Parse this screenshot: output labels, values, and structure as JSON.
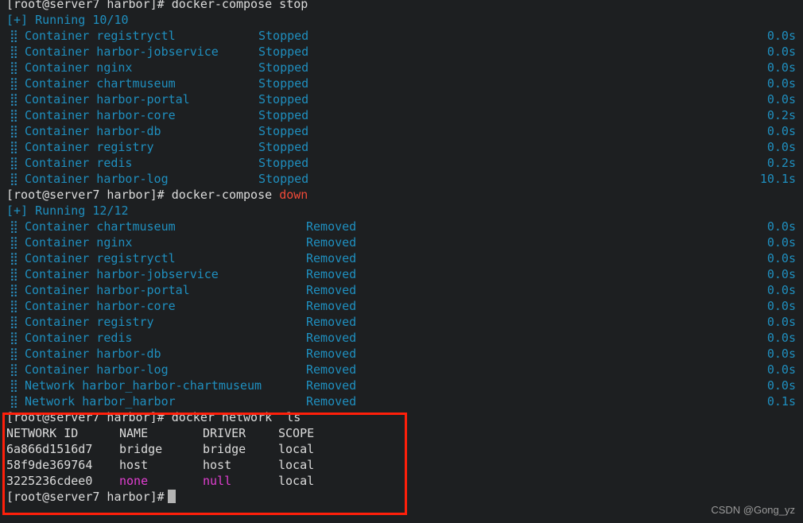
{
  "terminal": {
    "background": "#1d1f21",
    "foreground": "#dcdcdc",
    "accent_cyan": "#1f8fbf",
    "accent_red": "#f04a38",
    "accent_magenta": "#e23fd2",
    "annotation_box_color": "#ff1f0a",
    "bullet_glyph": "⣿"
  },
  "prompt": {
    "text": "[root@server7 harbor]# ",
    "cmd_stop": "docker-compose stop",
    "cmd_down_prefix": "docker-compose ",
    "cmd_down_arg": "down",
    "cmd_network_ls": "docker network  ls"
  },
  "stop_block": {
    "header": "[+] Running 10/10",
    "status_label": "Stopped",
    "rows": [
      {
        "kind": "Container",
        "name": "registryctl",
        "status": "Stopped",
        "time": "0.0s"
      },
      {
        "kind": "Container",
        "name": "harbor-jobservice",
        "status": "Stopped",
        "time": "0.0s"
      },
      {
        "kind": "Container",
        "name": "nginx",
        "status": "Stopped",
        "time": "0.0s"
      },
      {
        "kind": "Container",
        "name": "chartmuseum",
        "status": "Stopped",
        "time": "0.0s"
      },
      {
        "kind": "Container",
        "name": "harbor-portal",
        "status": "Stopped",
        "time": "0.0s"
      },
      {
        "kind": "Container",
        "name": "harbor-core",
        "status": "Stopped",
        "time": "0.2s"
      },
      {
        "kind": "Container",
        "name": "harbor-db",
        "status": "Stopped",
        "time": "0.0s"
      },
      {
        "kind": "Container",
        "name": "registry",
        "status": "Stopped",
        "time": "0.0s"
      },
      {
        "kind": "Container",
        "name": "redis",
        "status": "Stopped",
        "time": "0.2s"
      },
      {
        "kind": "Container",
        "name": "harbor-log",
        "status": "Stopped",
        "time": "10.1s"
      }
    ]
  },
  "down_block": {
    "header": "[+] Running 12/12",
    "status_label": "Removed",
    "rows": [
      {
        "kind": "Container",
        "name": "chartmuseum",
        "status": "Removed",
        "time": "0.0s"
      },
      {
        "kind": "Container",
        "name": "nginx",
        "status": "Removed",
        "time": "0.0s"
      },
      {
        "kind": "Container",
        "name": "registryctl",
        "status": "Removed",
        "time": "0.0s"
      },
      {
        "kind": "Container",
        "name": "harbor-jobservice",
        "status": "Removed",
        "time": "0.0s"
      },
      {
        "kind": "Container",
        "name": "harbor-portal",
        "status": "Removed",
        "time": "0.0s"
      },
      {
        "kind": "Container",
        "name": "harbor-core",
        "status": "Removed",
        "time": "0.0s"
      },
      {
        "kind": "Container",
        "name": "registry",
        "status": "Removed",
        "time": "0.0s"
      },
      {
        "kind": "Container",
        "name": "redis",
        "status": "Removed",
        "time": "0.0s"
      },
      {
        "kind": "Container",
        "name": "harbor-db",
        "status": "Removed",
        "time": "0.0s"
      },
      {
        "kind": "Container",
        "name": "harbor-log",
        "status": "Removed",
        "time": "0.0s"
      },
      {
        "kind": "Network",
        "name": "harbor_harbor-chartmuseum",
        "status": "Removed",
        "time": "0.0s"
      },
      {
        "kind": "Network",
        "name": "harbor_harbor",
        "status": "Removed",
        "time": "0.1s"
      }
    ]
  },
  "network_table": {
    "headers": [
      "NETWORK ID",
      "NAME",
      "DRIVER",
      "SCOPE"
    ],
    "rows": [
      {
        "id": "6a866d1516d7",
        "name": "bridge",
        "driver": "bridge",
        "scope": "local",
        "highlight": false
      },
      {
        "id": "58f9de369764",
        "name": "host",
        "driver": "host",
        "scope": "local",
        "highlight": false
      },
      {
        "id": "3225236cdee0",
        "name": "none",
        "driver": "null",
        "scope": "local",
        "highlight": true
      }
    ]
  },
  "watermark": {
    "text": "CSDN @Gong_yz"
  }
}
